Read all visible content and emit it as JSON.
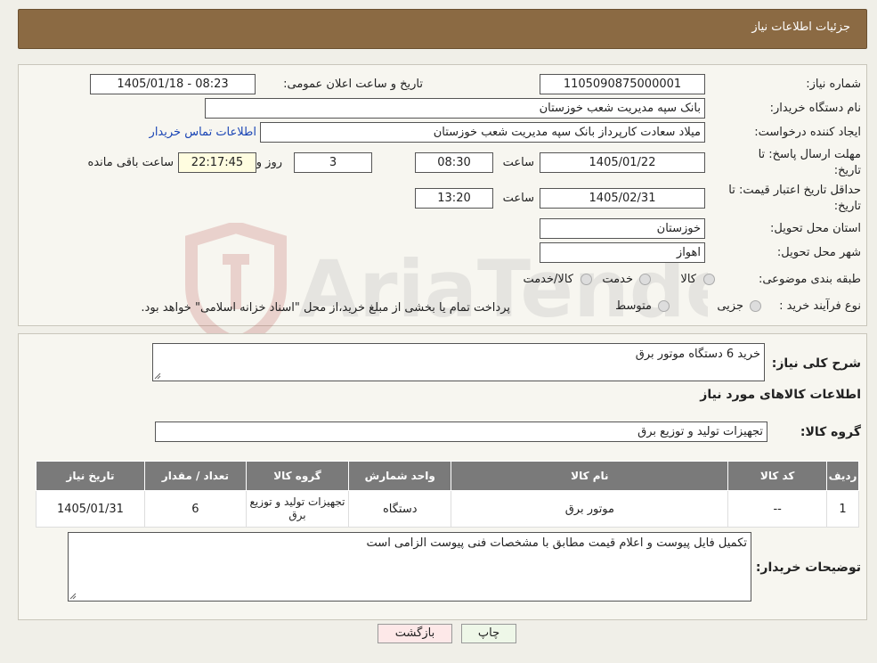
{
  "header": {
    "title": "جزئیات اطلاعات نیاز"
  },
  "watermark": {
    "text": "AriaTender.neT"
  },
  "form": {
    "need_number_label": "شماره نیاز:",
    "need_number": "1105090875000001",
    "announce_label": "تاریخ و ساعت اعلان عمومی:",
    "announce_value": "1405/01/18 - 08:23",
    "buyer_org_label": "نام دستگاه خریدار:",
    "buyer_org": "بانک سپه مدیریت شعب خوزستان",
    "creator_label": "ایجاد کننده درخواست:",
    "creator": "میلاد سعادت کارپرداز بانک سپه مدیریت شعب خوزستان",
    "contact_link": "اطلاعات تماس خریدار",
    "deadline_label_1": "مهلت ارسال پاسخ: تا",
    "deadline_label_2": "تاریخ:",
    "deadline_date": "1405/01/22",
    "time_label": "ساعت",
    "deadline_time": "08:30",
    "days_value": "3",
    "days_label": "روز و",
    "remaining_time": "22:17:45",
    "remaining_label": "ساعت باقی مانده",
    "validity_label_1": "حداقل تاریخ اعتبار قیمت: تا",
    "validity_label_2": "تاریخ:",
    "validity_date": "1405/02/31",
    "validity_time": "13:20",
    "province_label": "استان محل تحویل:",
    "province": "خوزستان",
    "city_label": "شهر محل تحویل:",
    "city": "اهواز",
    "category_label": "طبقه بندی موضوعی:",
    "category_options": [
      "کالا",
      "خدمت",
      "کالا/خدمت"
    ],
    "process_label": "نوع فرآیند خرید :",
    "process_options": [
      "جزیی",
      "متوسط"
    ],
    "process_note": "پرداخت تمام یا بخشی از مبلغ خرید،از محل \"اسناد خزانه اسلامی\" خواهد بود."
  },
  "summary": {
    "label": "شرح کلی نیاز:",
    "value": "خرید 6 دستگاه موتور برق",
    "items_title": "اطلاعات کالاهای مورد نیاز",
    "group_label": "گروه کالا:",
    "group_value": "تجهیزات تولید و توزیع برق"
  },
  "table": {
    "headers": [
      "ردیف",
      "کد کالا",
      "نام کالا",
      "واحد شمارش",
      "گروه کالا",
      "تعداد / مقدار",
      "تاریخ نیاز"
    ],
    "rows": [
      [
        "1",
        "--",
        "موتور برق",
        "دستگاه",
        "تجهیزات تولید و توزیع برق",
        "6",
        "1405/01/31"
      ]
    ]
  },
  "notes": {
    "label": "توضیحات خریدار:",
    "value": "تکمیل فایل پیوست و اعلام قیمت مطابق با مشخصات فنی پیوست الزامی است"
  },
  "buttons": {
    "print": "چاپ",
    "back": "بازگشت"
  },
  "colors": {
    "header": "#8b6a43",
    "table_header": "#7a7a7a",
    "link": "#1a45b5",
    "back_button": "#fde8e8"
  }
}
